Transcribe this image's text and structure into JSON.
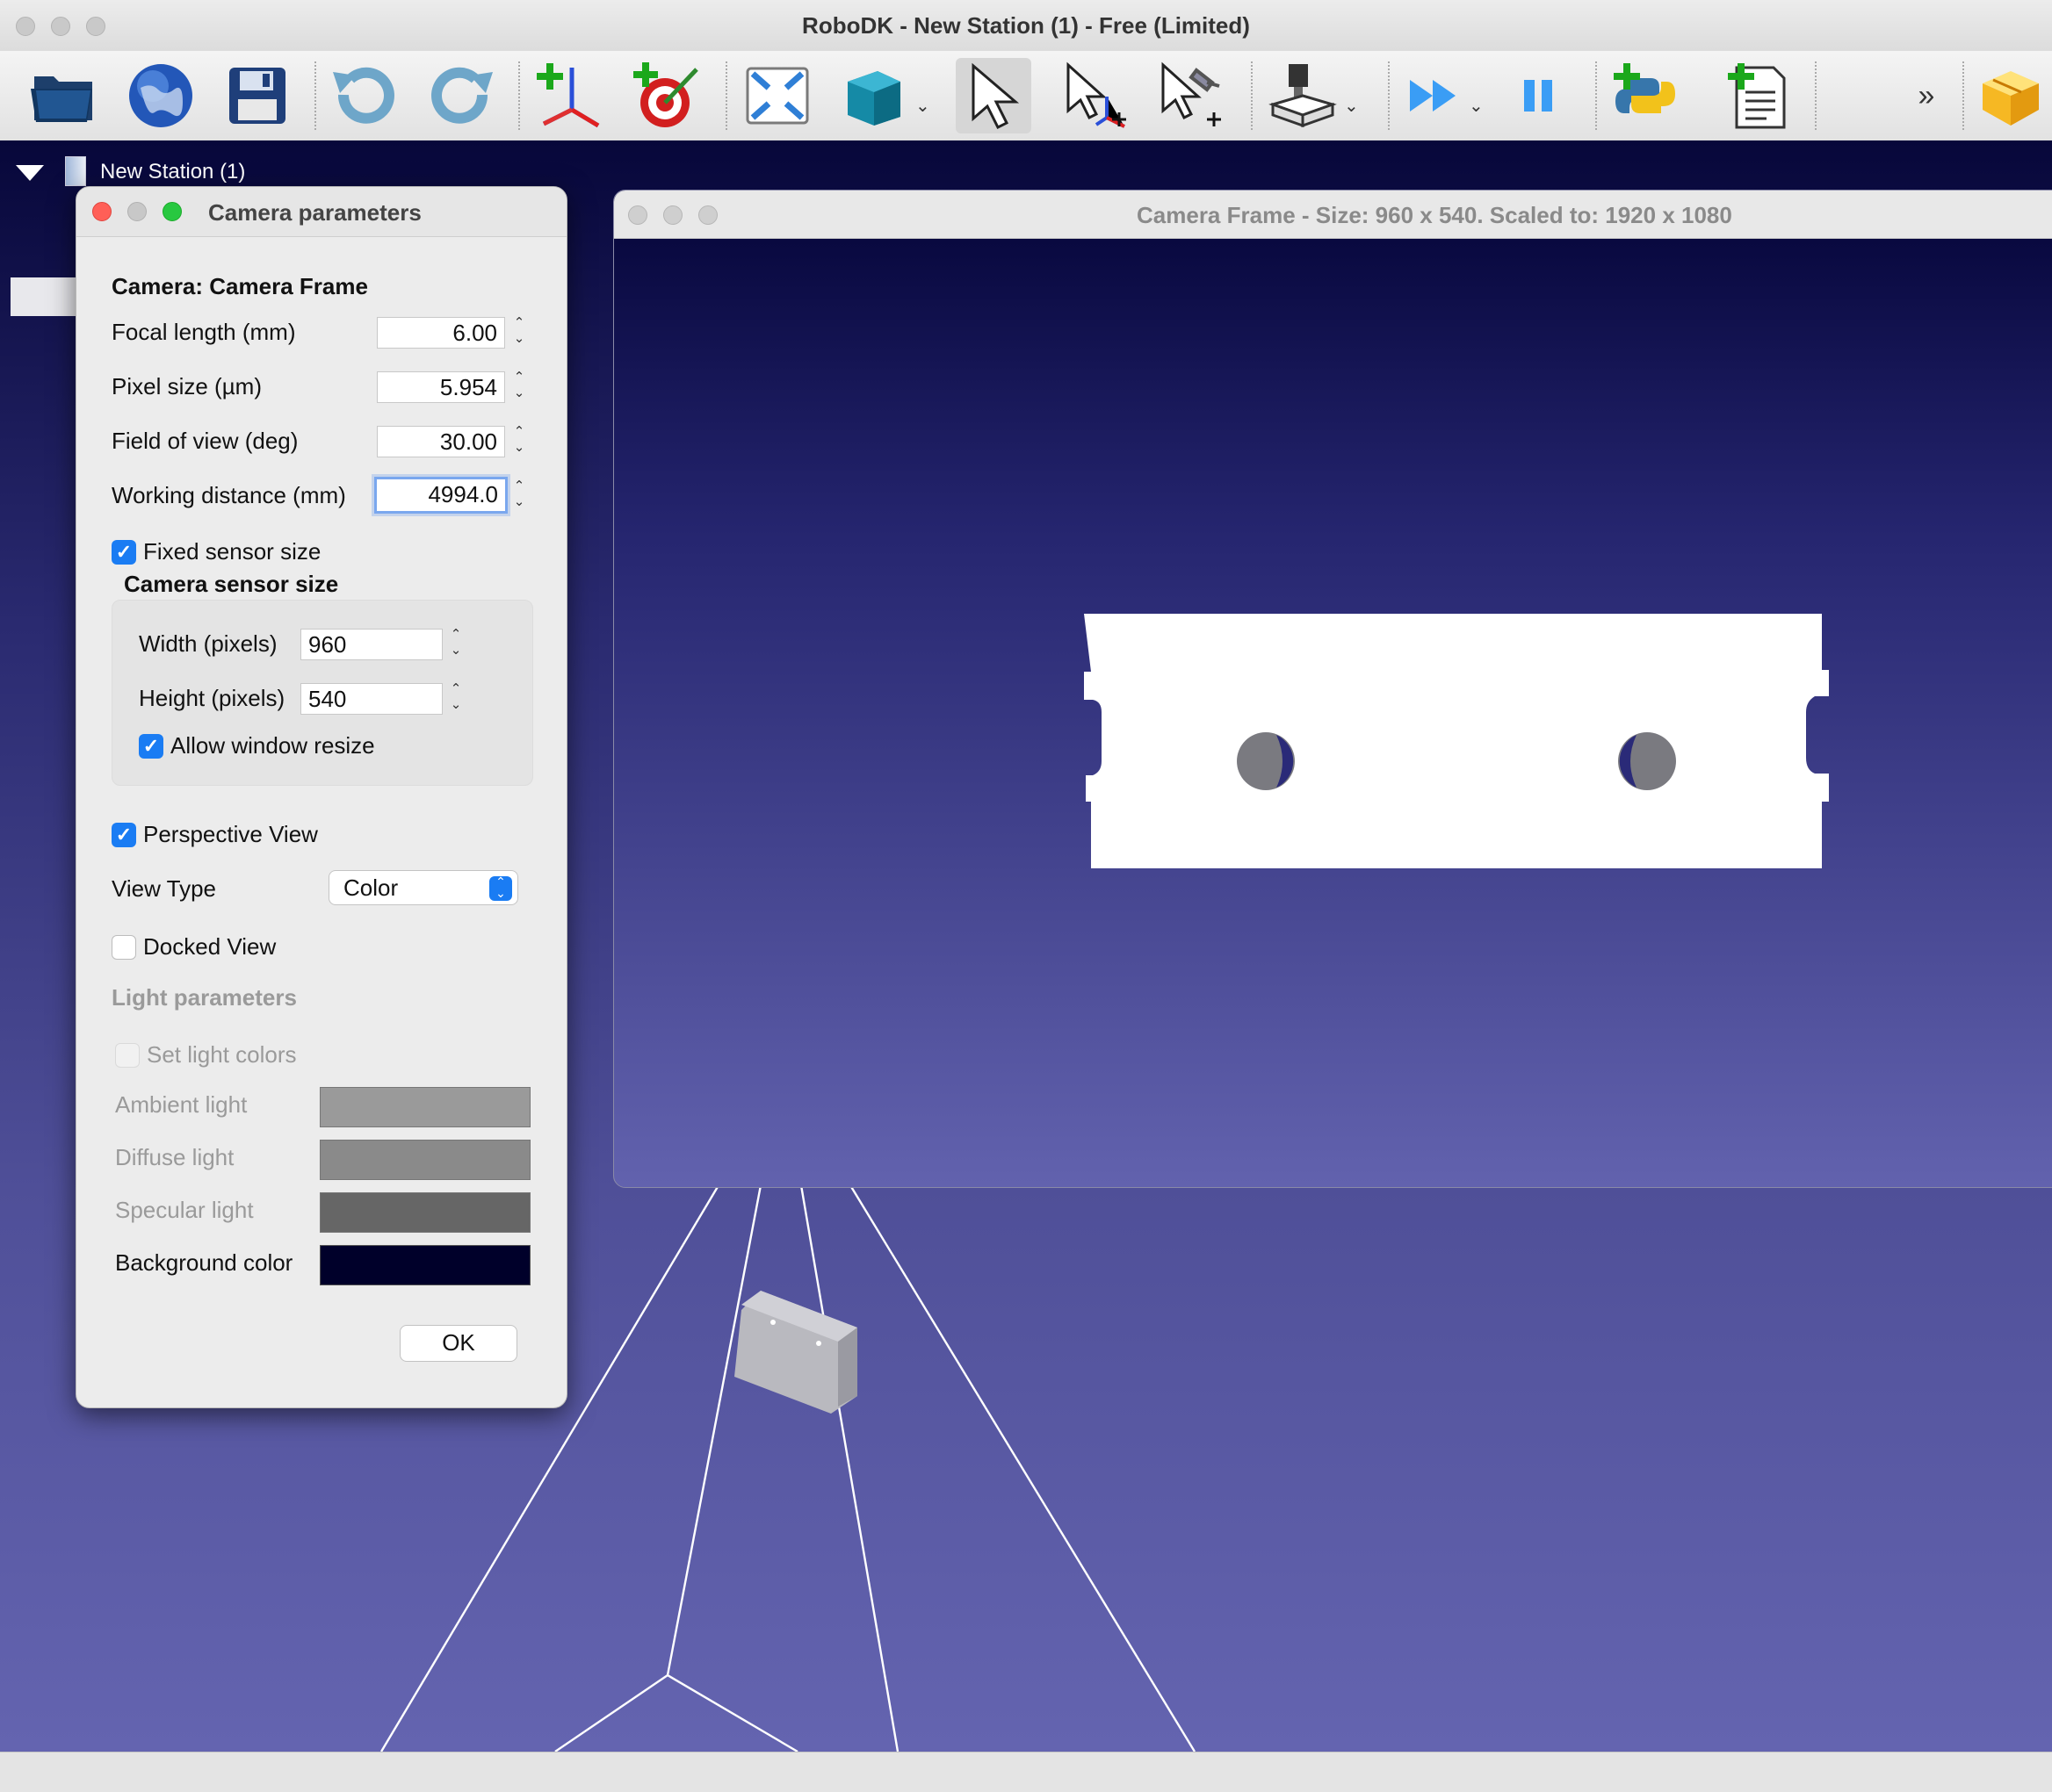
{
  "window": {
    "title": "RoboDK - New Station (1) - Free (Limited)"
  },
  "toolbar": {
    "buttons": [
      {
        "name": "open-icon"
      },
      {
        "name": "library-globe-icon"
      },
      {
        "name": "save-icon"
      },
      {
        "name": "undo-icon"
      },
      {
        "name": "redo-icon"
      },
      {
        "name": "add-reference-frame-icon"
      },
      {
        "name": "add-target-icon"
      },
      {
        "name": "fit-all-icon"
      },
      {
        "name": "view-cube-icon"
      },
      {
        "name": "select-pointer-icon"
      },
      {
        "name": "move-reference-icon"
      },
      {
        "name": "move-tool-icon"
      },
      {
        "name": "machining-project-icon"
      },
      {
        "name": "fast-simulation-icon"
      },
      {
        "name": "pause-icon"
      },
      {
        "name": "add-python-program-icon"
      },
      {
        "name": "add-program-icon"
      },
      {
        "name": "more-chevron-icon"
      },
      {
        "name": "add-in-box-icon"
      }
    ],
    "overflow_label": "»"
  },
  "tree": {
    "station": "New Station (1)"
  },
  "dialog": {
    "title": "Camera parameters",
    "camera_label": "Camera: Camera Frame",
    "focal_label": "Focal length (mm)",
    "focal_value": "6.00",
    "pixel_label": "Pixel size (µm)",
    "pixel_value": "5.954",
    "fov_label": "Field of view (deg)",
    "fov_value": "30.00",
    "wd_label": "Working distance (mm)",
    "wd_value": "4994.0",
    "fixed_sensor_label": "Fixed sensor size",
    "fixed_sensor_checked": true,
    "sensor_group_label": "Camera sensor size",
    "width_label": "Width (pixels)",
    "width_value": "960",
    "height_label": "Height (pixels)",
    "height_value": "540",
    "allow_resize_label": "Allow window resize",
    "allow_resize_checked": true,
    "perspective_label": "Perspective View",
    "perspective_checked": true,
    "view_type_label": "View Type",
    "view_type_value": "Color",
    "docked_label": "Docked View",
    "docked_checked": false,
    "light_params_label": "Light parameters",
    "set_light_label": "Set light colors",
    "ambient_label": "Ambient light",
    "ambient_color": "#9a9a9a",
    "diffuse_label": "Diffuse light",
    "diffuse_color": "#8a8a8a",
    "specular_label": "Specular light",
    "specular_color": "#666666",
    "background_label": "Background color",
    "background_color": "#00002a",
    "ok_label": "OK"
  },
  "camera_window": {
    "title": "Camera Frame - Size: 960 x 540. Scaled to: 1920 x 1080"
  },
  "colors": {
    "accent": "#1a7cf3",
    "close": "#ff5f57",
    "minimize": "#c8c8c8",
    "zoom": "#28c840"
  }
}
